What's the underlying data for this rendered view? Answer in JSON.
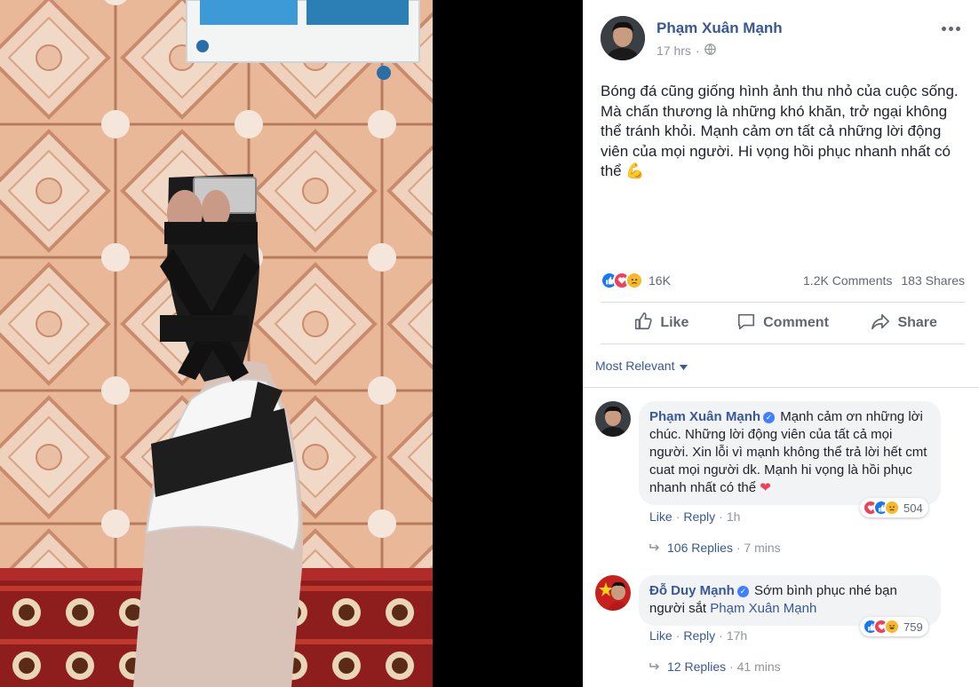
{
  "post": {
    "author": "Phạm Xuân Mạnh",
    "time": "17 hrs",
    "privacy_icon": "globe-icon",
    "text": "Bóng đá cũng giống hình ảnh thu nhỏ của cuộc sống. Mà chấn thương là những khó khăn, trở ngại không thể tránh khỏi. Mạnh cảm ơn tất cả những lời động viên của mọi người. Hi vọng hồi phục nhanh nhất có thể 💪",
    "reaction_count": "16K",
    "comments_count": "1.2K Comments",
    "shares_count": "183 Shares"
  },
  "actions": {
    "like": "Like",
    "comment": "Comment",
    "share": "Share"
  },
  "sort_label": "Most Relevant",
  "comments": [
    {
      "author": "Phạm Xuân Mạnh",
      "verified": true,
      "text": "Mạnh cảm ơn những lời chúc. Những lời động viên của tất cả mọi người. Xin lỗi vì mạnh không thể trả lời hết cmt cuat mọi người dk. Mạnh hi vọng là hồi phục nhanh nhất có thể",
      "emoji": "❤",
      "reaction_count": "504",
      "like": "Like",
      "reply": "Reply",
      "time": "1h",
      "replies": "106 Replies",
      "replies_time": "7 mins"
    },
    {
      "author": "Đỗ Duy Mạnh",
      "verified": true,
      "text": "Sớm bình phục nhé bạn người sắt",
      "mention": "Phạm Xuân Mạnh",
      "reaction_count": "759",
      "like": "Like",
      "reply": "Reply",
      "time": "17h",
      "replies": "12 Replies",
      "replies_time": "41 mins"
    }
  ],
  "colors": {
    "link": "#385898",
    "secondary": "#90949c",
    "like_blue": "#1877f2",
    "love_red": "#f33e58",
    "sad_yellow": "#f7b928"
  }
}
